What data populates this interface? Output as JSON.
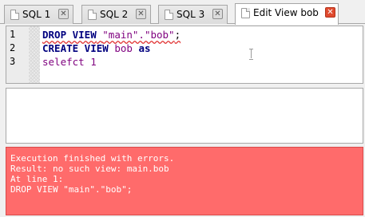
{
  "tabs": [
    {
      "label": "SQL 1",
      "close": "✕",
      "active": false
    },
    {
      "label": "SQL 2",
      "close": "✕",
      "active": false
    },
    {
      "label": "SQL 3",
      "close": "✕",
      "active": false
    },
    {
      "label": "Edit View bob",
      "close": "✕",
      "active": true
    }
  ],
  "editor": {
    "line_numbers": [
      "1",
      "2",
      "3"
    ],
    "lines": [
      {
        "t1": "DROP VIEW",
        "t2": " ",
        "t3": "\"main\".\"bob\"",
        "t4": ";"
      },
      {
        "t1": "CREATE VIEW",
        "t2": " bob ",
        "t3": "as"
      },
      {
        "t1": "selefct 1"
      }
    ]
  },
  "error_log": {
    "lines": [
      "Execution finished with errors.",
      "Result: no such view: main.bob",
      "At line 1:",
      "DROP VIEW \"main\".\"bob\";"
    ]
  },
  "colors": {
    "error_bg": "#ff6b6b",
    "keyword": "#00007f",
    "string": "#7f007f",
    "tab_close_active": "#e04a2e"
  }
}
